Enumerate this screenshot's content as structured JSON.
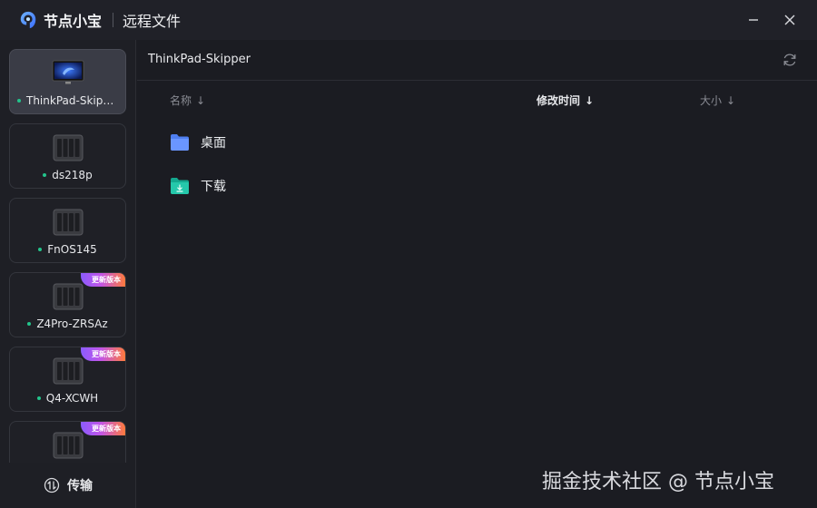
{
  "app": {
    "name": "节点小宝",
    "window_title": "远程文件"
  },
  "devices": [
    {
      "name": "ThinkPad-Skipper",
      "kind": "laptop",
      "online": true,
      "active": true,
      "badge": ""
    },
    {
      "name": "ds218p",
      "kind": "nas",
      "online": true,
      "active": false,
      "badge": ""
    },
    {
      "name": "FnOS145",
      "kind": "nas",
      "online": true,
      "active": false,
      "badge": ""
    },
    {
      "name": "Z4Pro-ZRSAz",
      "kind": "nas",
      "online": true,
      "active": false,
      "badge": "更新版本"
    },
    {
      "name": "Q4-XCWH",
      "kind": "nas",
      "online": true,
      "active": false,
      "badge": "更新版本"
    },
    {
      "name": "",
      "kind": "nas",
      "online": true,
      "active": false,
      "badge": "更新版本"
    }
  ],
  "sidebar": {
    "transfer_label": "传输"
  },
  "browser": {
    "path": "ThinkPad-Skipper",
    "columns": {
      "name": "名称",
      "mtime": "修改时间",
      "size": "大小",
      "sort_arrow": "↓"
    },
    "files": [
      {
        "name": "桌面",
        "icon": "folder-desktop-icon"
      },
      {
        "name": "下载",
        "icon": "folder-download-icon"
      }
    ]
  },
  "watermark": "掘金技术社区 @ 节点小宝",
  "colors": {
    "online": "#23c48b",
    "active_card": "#3a3c46",
    "desktop_folder": "#5b8cff",
    "download_folder": "#1fbfa6"
  }
}
